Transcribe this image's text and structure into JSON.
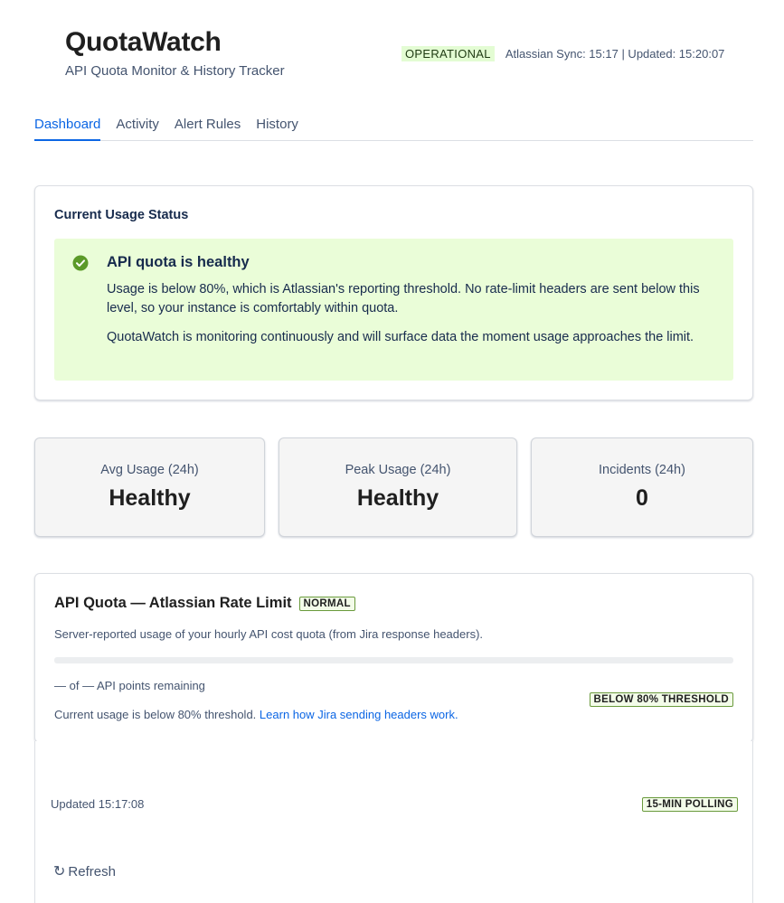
{
  "app": {
    "title": "QuotaWatch",
    "subtitle": "API Quota Monitor & History Tracker"
  },
  "status": {
    "badge": "OPERATIONAL",
    "sync_text": "Atlassian Sync: 15:17 | Updated: 15:20:07"
  },
  "tabs": [
    {
      "label": "Dashboard",
      "active": true
    },
    {
      "label": "Activity",
      "active": false
    },
    {
      "label": "Alert Rules",
      "active": false
    },
    {
      "label": "History",
      "active": false
    }
  ],
  "current_status": {
    "title": "Current Usage Status",
    "healthy_title": "API quota is healthy",
    "paragraph1": "Usage is below 80%, which is Atlassian's reporting threshold. No rate-limit headers are sent below this level, so your instance is comfortably within quota.",
    "paragraph2": "QuotaWatch is monitoring continuously and will surface data the moment usage approaches the limit.",
    "icon": "check-circle-icon"
  },
  "stats": [
    {
      "label": "Avg Usage (24h)",
      "value": "Healthy"
    },
    {
      "label": "Peak Usage (24h)",
      "value": "Healthy"
    },
    {
      "label": "Incidents (24h)",
      "value": "0"
    }
  ],
  "quota": {
    "title": "API Quota — Atlassian Rate Limit",
    "badge": "NORMAL",
    "description": "Server-reported usage of your hourly API cost quota (from Jira response headers).",
    "progress_fraction": 0,
    "remaining": "— of — API points remaining",
    "threshold_badge": "BELOW 80% THRESHOLD",
    "usage_note": "Current usage is below 80% threshold.",
    "link_text": "Learn how Jira sending headers work."
  },
  "footer": {
    "updated": "Updated 15:17:08",
    "polling_badge": "15-MIN POLLING",
    "refresh_label": "Refresh",
    "refresh_icon": "↻"
  },
  "colors": {
    "accent": "#0c66e4",
    "healthy_bg": "#eafdd8",
    "success": "#6a9a3c"
  }
}
